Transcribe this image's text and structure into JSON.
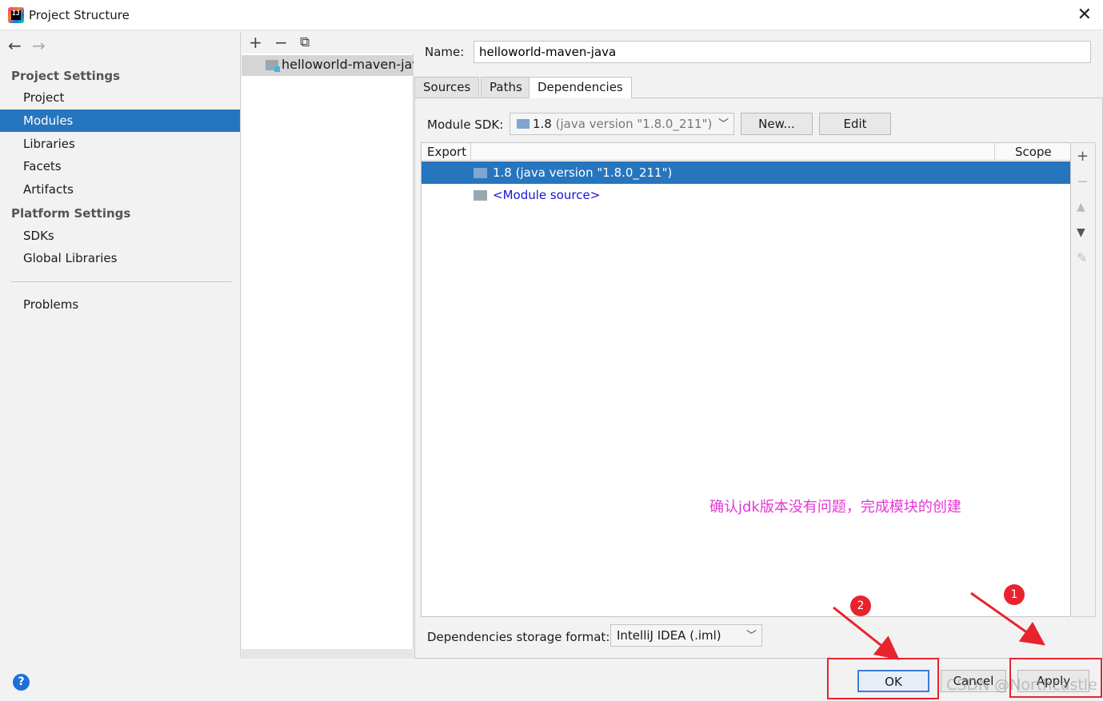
{
  "window": {
    "title": "Project Structure"
  },
  "nav": {
    "back_icon": "arrow-left-icon",
    "forward_icon": "arrow-right-icon",
    "project_settings_header": "Project Settings",
    "project_settings_items": [
      "Project",
      "Modules",
      "Libraries",
      "Facets",
      "Artifacts"
    ],
    "selected": "Modules",
    "platform_settings_header": "Platform Settings",
    "platform_settings_items": [
      "SDKs",
      "Global Libraries"
    ],
    "problems": "Problems"
  },
  "modules": {
    "toolbar_icons": [
      "plus-icon",
      "minus-icon",
      "copy-icon"
    ],
    "items": [
      "helloworld-maven-java"
    ]
  },
  "module": {
    "name_label": "Name:",
    "name_value": "helloworld-maven-java",
    "tabs": [
      "Sources",
      "Paths",
      "Dependencies"
    ],
    "active_tab": "Dependencies",
    "sdk_label": "Module SDK:",
    "sdk_value_main": "1.8",
    "sdk_value_detail": " (java version \"1.8.0_211\")",
    "new_button": "New...",
    "edit_button": "Edit",
    "table_headers": {
      "export": "Export",
      "scope": "Scope"
    },
    "dependencies": [
      {
        "label": "1.8 (java version \"1.8.0_211\")",
        "selected": true
      },
      {
        "label": "<Module source>",
        "selected": false
      }
    ],
    "annotation": "确认jdk版本没有问题，完成模块的创建",
    "storage_label": "Dependencies storage format:",
    "storage_value": "IntelliJ IDEA (.iml)"
  },
  "footer": {
    "help": "?",
    "ok": "OK",
    "cancel": "Cancel",
    "apply": "Apply",
    "marker_ok": "2",
    "marker_apply": "1",
    "watermark": "CSDN @Northcastle"
  },
  "colors": {
    "selection": "#2675bf",
    "annotation": "#e536d6",
    "highlight": "#e8232d"
  }
}
